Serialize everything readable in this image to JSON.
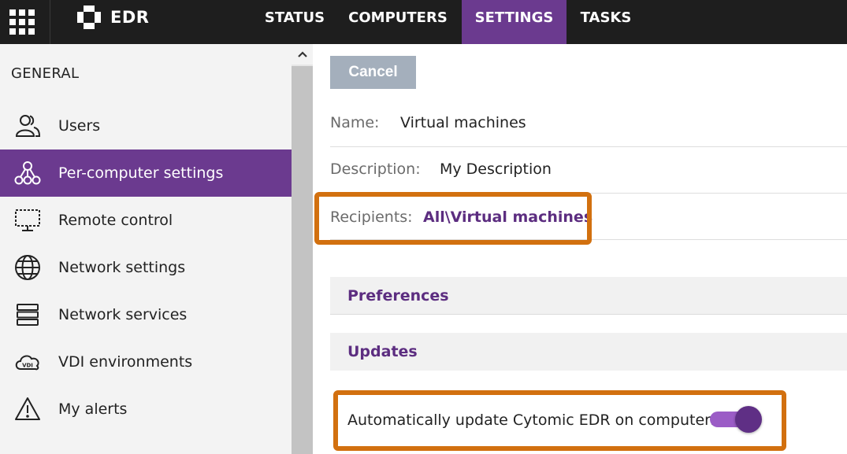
{
  "header": {
    "app_name": "EDR",
    "tabs": [
      {
        "label": "STATUS",
        "active": false
      },
      {
        "label": "COMPUTERS",
        "active": false
      },
      {
        "label": "SETTINGS",
        "active": true
      },
      {
        "label": "TASKS",
        "active": false
      }
    ]
  },
  "sidebar": {
    "title": "GENERAL",
    "items": [
      {
        "label": "Users",
        "icon": "users-icon",
        "active": false
      },
      {
        "label": "Per-computer settings",
        "icon": "network-nodes-icon",
        "active": true
      },
      {
        "label": "Remote control",
        "icon": "remote-screen-icon",
        "active": false
      },
      {
        "label": "Network settings",
        "icon": "globe-icon",
        "active": false
      },
      {
        "label": "Network services",
        "icon": "server-stack-icon",
        "active": false
      },
      {
        "label": "VDI environments",
        "icon": "vdi-cloud-icon",
        "active": false
      },
      {
        "label": "My alerts",
        "icon": "warning-triangle-icon",
        "active": false
      }
    ],
    "scroll_up_icon": "chevron-up-icon"
  },
  "main": {
    "cancel_label": "Cancel",
    "fields": {
      "name": {
        "label": "Name:",
        "value": "Virtual machines"
      },
      "description": {
        "label": "Description:",
        "value": "My Description"
      },
      "recipients": {
        "label": "Recipients:",
        "value": "All\\Virtual machines"
      }
    },
    "sections": {
      "preferences": "Preferences",
      "updates": "Updates"
    },
    "auto_update": {
      "label": "Automatically update Cytomic EDR on computers",
      "enabled": true
    }
  },
  "colors": {
    "topbar": "#1e1e1e",
    "accent": "#6b3a8f",
    "highlight": "#d2700f",
    "link": "#5c2d80",
    "cancel_button": "#a4afbc"
  }
}
